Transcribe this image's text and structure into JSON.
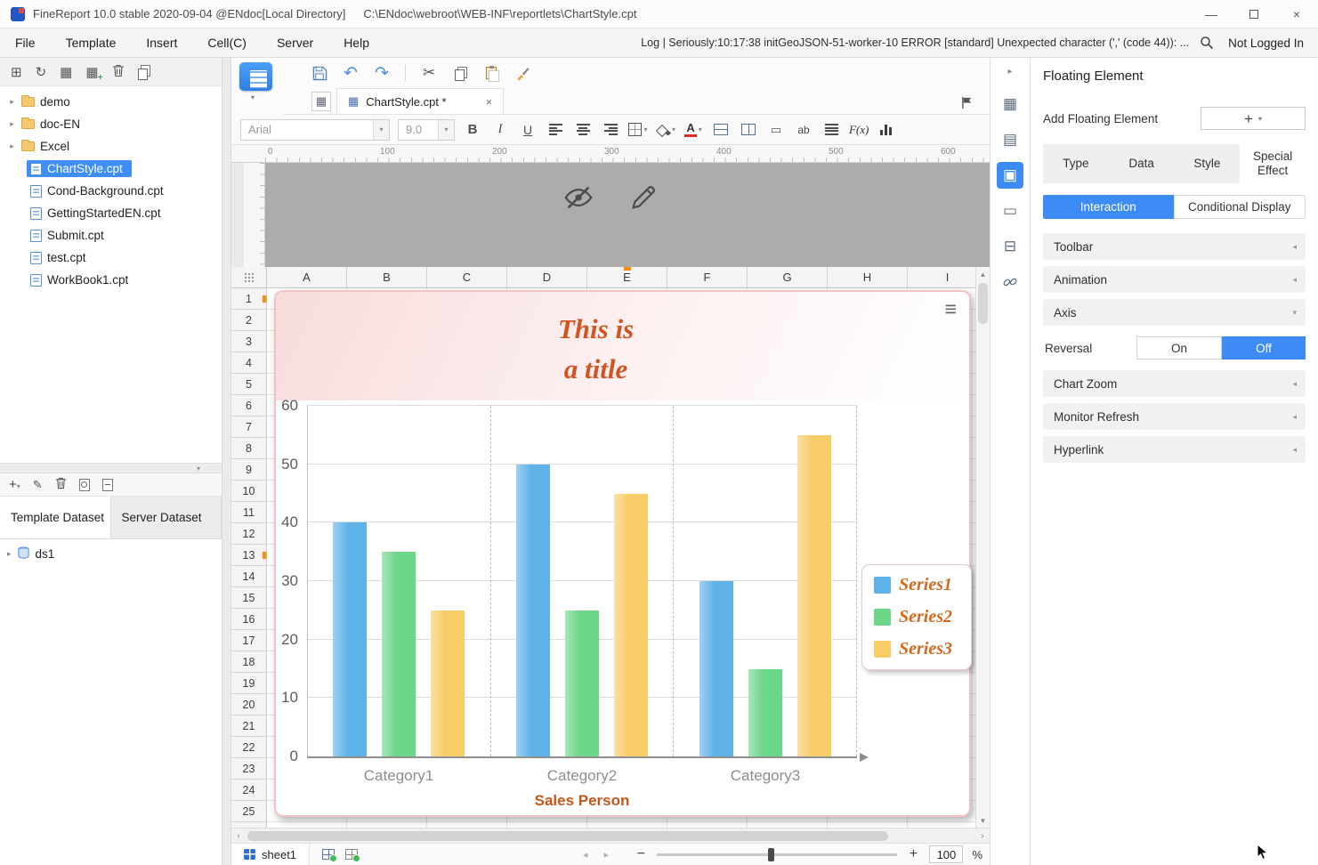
{
  "titlebar": {
    "app_title": "FineReport 10.0 stable 2020-09-04 @ENdoc[Local Directory]",
    "file_path": "C:\\ENdoc\\webroot\\WEB-INF\\reportlets\\ChartStyle.cpt"
  },
  "menubar": {
    "items": [
      "File",
      "Template",
      "Insert",
      "Cell(C)",
      "Server",
      "Help"
    ],
    "log_text": "Log | Seriously:10:17:38 initGeoJSON-51-worker-10 ERROR [standard] Unexpected character (',' (code 44)): ...",
    "login_status": "Not Logged In"
  },
  "file_tree": {
    "items": [
      {
        "label": "demo",
        "type": "folder"
      },
      {
        "label": "doc-EN",
        "type": "folder"
      },
      {
        "label": "Excel",
        "type": "folder"
      },
      {
        "label": "ChartStyle.cpt",
        "type": "file",
        "selected": true
      },
      {
        "label": "Cond-Background.cpt",
        "type": "file"
      },
      {
        "label": "GettingStartedEN.cpt",
        "type": "file"
      },
      {
        "label": "Submit.cpt",
        "type": "file"
      },
      {
        "label": "test.cpt",
        "type": "file"
      },
      {
        "label": "WorkBook1.cpt",
        "type": "file"
      }
    ]
  },
  "dataset_panel": {
    "tabs": [
      "Template Dataset",
      "Server Dataset"
    ],
    "active_tab": "Template Dataset",
    "items": [
      {
        "label": "ds1"
      }
    ]
  },
  "editor": {
    "open_tab": "ChartStyle.cpt *",
    "font_family": "Arial",
    "font_size": "9.0",
    "bold": "B",
    "italic": "I",
    "underline": "U",
    "ab_label": "ab",
    "fx_label": "F(x)",
    "font_color_label": "A",
    "ruler_marks": [
      "0",
      "100",
      "200",
      "300",
      "400",
      "500",
      "600"
    ]
  },
  "spreadsheet": {
    "columns": [
      "A",
      "B",
      "C",
      "D",
      "E",
      "F",
      "G",
      "H",
      "I"
    ],
    "rows": [
      "1",
      "2",
      "3",
      "4",
      "5",
      "6",
      "7",
      "8",
      "9",
      "10",
      "11",
      "12",
      "13",
      "14",
      "15",
      "16",
      "17",
      "18",
      "19",
      "20",
      "21",
      "22",
      "23",
      "24",
      "25"
    ]
  },
  "chart_data": {
    "type": "bar",
    "title": "This is a title",
    "title_lines": [
      "This is",
      "a title"
    ],
    "categories": [
      "Category1",
      "Category2",
      "Category3"
    ],
    "series": [
      {
        "name": "Series1",
        "color": "#5eb2e8",
        "values": [
          40,
          50,
          30
        ]
      },
      {
        "name": "Series2",
        "color": "#6cd689",
        "values": [
          35,
          25,
          15
        ]
      },
      {
        "name": "Series3",
        "color": "#f8cc66",
        "values": [
          25,
          45,
          55
        ]
      }
    ],
    "xlabel": "Sales Person",
    "ylabel": "",
    "ylim": [
      0,
      60
    ],
    "yticks": [
      0,
      10,
      20,
      30,
      40,
      50,
      60
    ],
    "grid": true,
    "legend_position": "right"
  },
  "sheet_bar": {
    "sheet_name": "sheet1",
    "zoom_value": "100",
    "zoom_unit": "%"
  },
  "right_panel": {
    "title": "Floating Element",
    "add_label": "Add Floating Element",
    "tabs": [
      "Type",
      "Data",
      "Style",
      "Special Effect"
    ],
    "active_tab": "Special Effect",
    "sub_tabs": [
      "Interaction",
      "Conditional Display"
    ],
    "active_sub_tab": "Interaction",
    "sections": [
      "Toolbar",
      "Animation",
      "Axis",
      "Chart Zoom",
      "Monitor Refresh",
      "Hyperlink"
    ],
    "reversal": {
      "label": "Reversal",
      "on_label": "On",
      "off_label": "Off",
      "selected": "Off"
    },
    "accent_color": "#3d8cf5"
  }
}
